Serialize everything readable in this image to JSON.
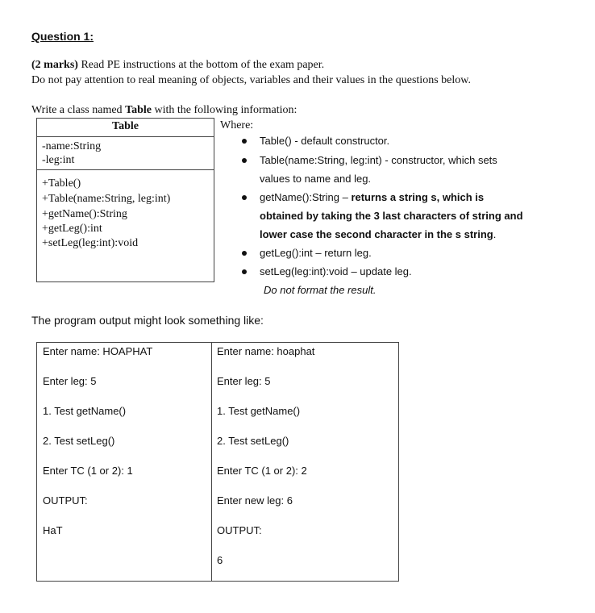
{
  "question": {
    "title": "Question 1:",
    "marks": "(2 marks)",
    "instruction1_rest": " Read PE instructions at the bottom of the exam paper.",
    "instruction2": "Do not pay attention to real  meaning of objects, variables and their values in the questions below.",
    "write_prefix": "Write  a class named ",
    "class_name": "Table",
    "write_suffix": " with the following information:"
  },
  "uml": {
    "header": "Table",
    "attributes": [
      "-name:String",
      "-leg:int"
    ],
    "methods": [
      "+Table()",
      "+Table(name:String, leg:int)",
      "+getName():String",
      "+getLeg():int",
      "+setLeg(leg:int):void"
    ]
  },
  "where": {
    "label": "Where:",
    "b1": "Table() - default constructor.",
    "b2_line1": "Table(name:String, leg:int) - constructor, which sets",
    "b2_line2": "values to name and leg.",
    "b3_normal": "getName():String  –  ",
    "b3_bold1": "returns  a  string  s,  which  is",
    "b3_bold2": "obtained by taking the 3 last characters of string and",
    "b3_bold3": "lower case the second character in the s string",
    "b3_end": ".",
    "b4": "getLeg():int – return leg.",
    "b5": "setLeg(leg:int):void – update leg.",
    "note": "Do not format the result."
  },
  "output": {
    "intro": "The program output might look something like:",
    "left": [
      "Enter name: HOAPHAT",
      "Enter leg: 5",
      "1. Test getName()",
      "2. Test setLeg()",
      "Enter TC (1 or 2): 1",
      "OUTPUT:",
      "HaT"
    ],
    "right": [
      "Enter name: hoaphat",
      "Enter leg: 5",
      "1. Test getName()",
      "2. Test setLeg()",
      "Enter TC (1 or 2): 2",
      "Enter new leg: 6",
      "OUTPUT:",
      "6"
    ]
  }
}
